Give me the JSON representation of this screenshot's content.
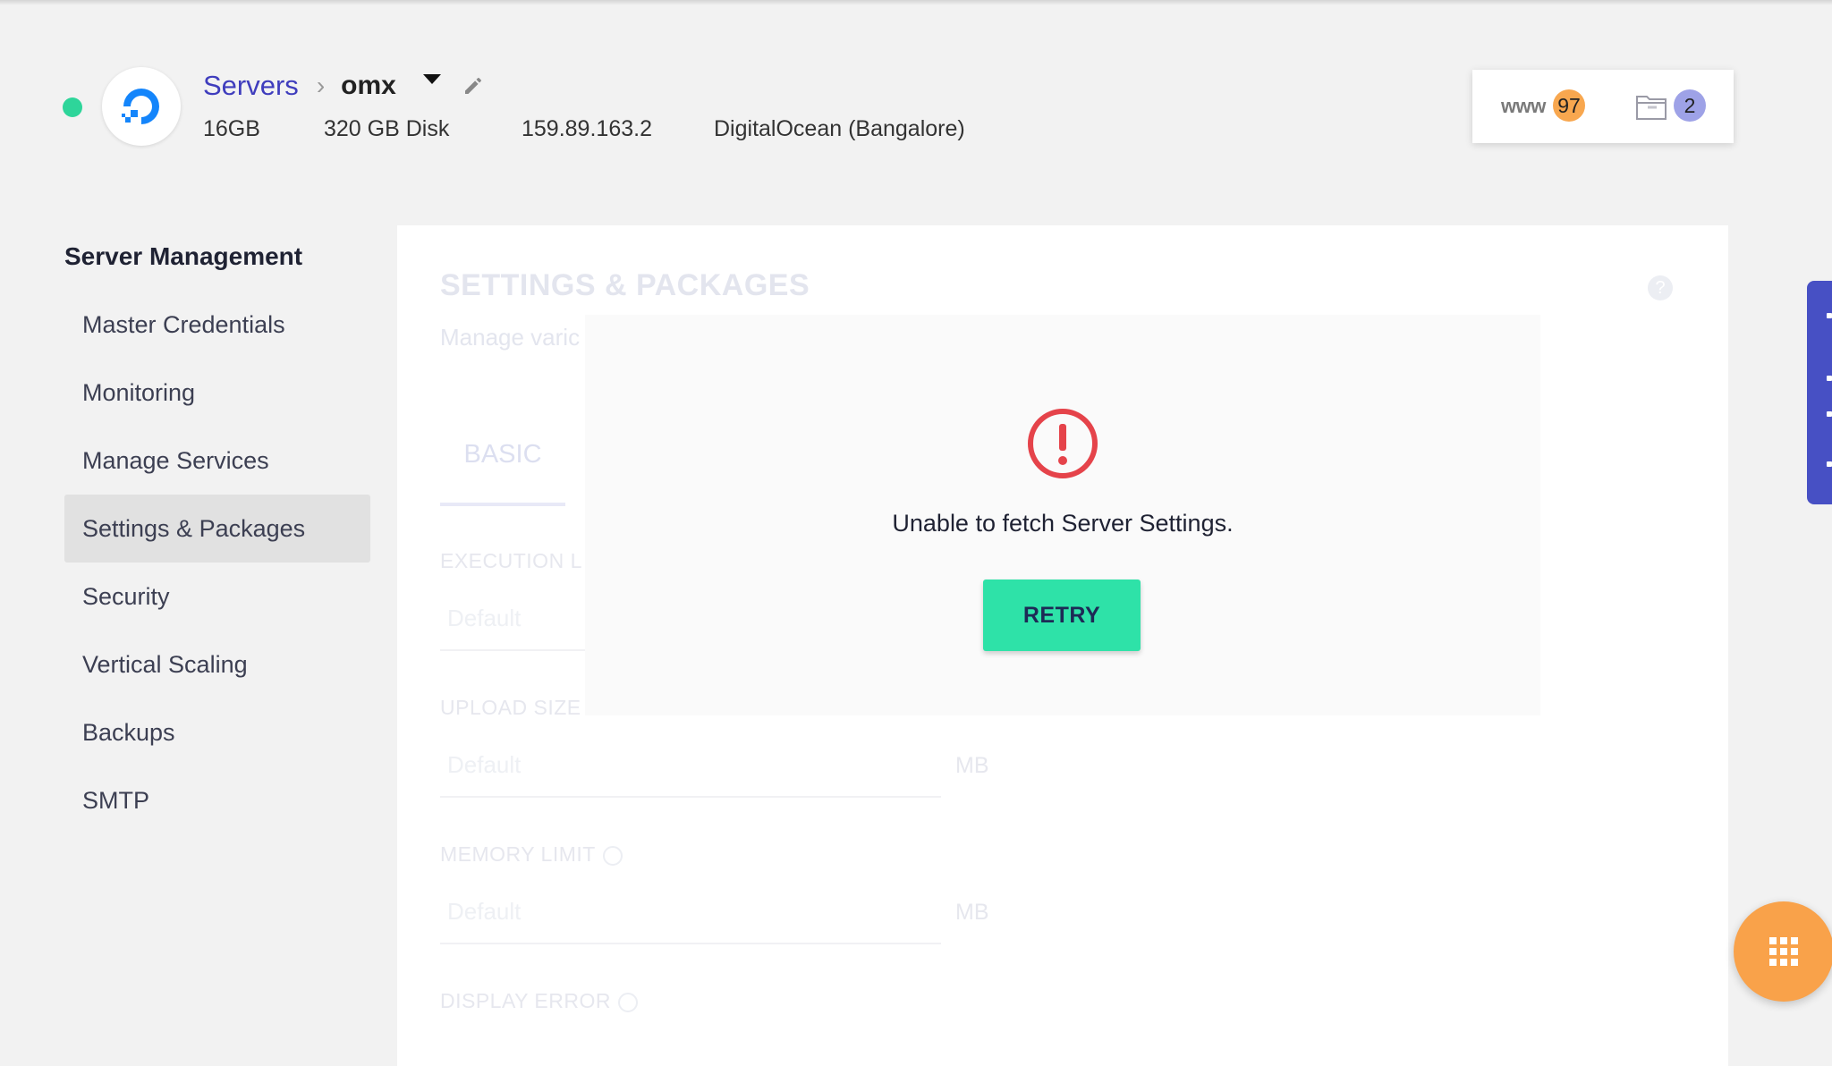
{
  "header": {
    "status_color": "#2ed59a",
    "logo_icon": "digitalocean-logo",
    "breadcrumb": {
      "servers": "Servers",
      "separator": "›",
      "server_name": "omx"
    },
    "meta": {
      "ram": "16GB",
      "disk": "320 GB Disk",
      "ip": "159.89.163.2",
      "provider": "DigitalOcean (Bangalore)"
    },
    "counters": {
      "www_label": "www",
      "apps_count": "97",
      "files_count": "2"
    }
  },
  "sidebar": {
    "title": "Server Management",
    "items": [
      {
        "label": "Master Credentials"
      },
      {
        "label": "Monitoring"
      },
      {
        "label": "Manage Services"
      },
      {
        "label": "Settings & Packages",
        "active": true
      },
      {
        "label": "Security"
      },
      {
        "label": "Vertical Scaling"
      },
      {
        "label": "Backups"
      },
      {
        "label": "SMTP"
      }
    ]
  },
  "main": {
    "title": "SETTINGS & PACKAGES",
    "subtitle": "Manage varic",
    "help": "?",
    "tab": "BASIC",
    "fields": [
      {
        "label": "EXECUTION L",
        "placeholder": "Default",
        "unit": ""
      },
      {
        "label": "UPLOAD SIZE",
        "placeholder": "Default",
        "unit": "MB"
      },
      {
        "label": "MEMORY LIMIT",
        "placeholder": "Default",
        "unit": "MB"
      },
      {
        "label": "DISPLAY ERROR",
        "placeholder": "",
        "unit": ""
      }
    ],
    "error": {
      "message": "Unable to fetch Server Settings.",
      "retry_label": "RETRY"
    }
  },
  "colors": {
    "accent": "#3f3dbd",
    "retry": "#2ee2a8",
    "error": "#e5434a",
    "fab": "#f9a24a",
    "edge_tab": "#4750c4"
  }
}
